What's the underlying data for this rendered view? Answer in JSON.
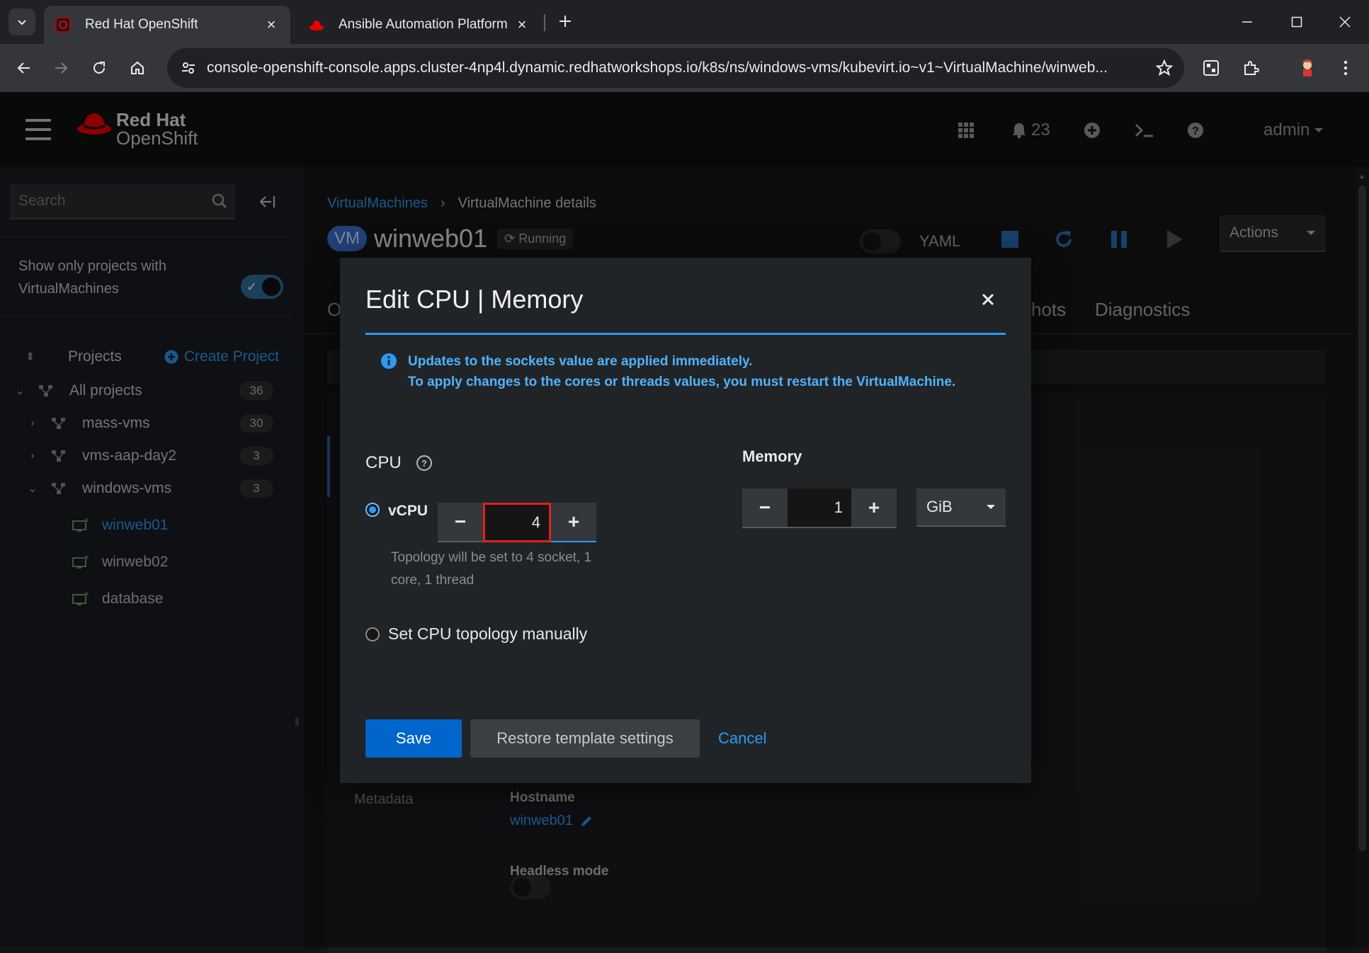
{
  "browser": {
    "tabs": [
      {
        "title": "Red Hat OpenShift",
        "active": true
      },
      {
        "title": "Ansible Automation Platform",
        "active": false
      }
    ],
    "url": "console-openshift-console.apps.cluster-4np4l.dynamic.redhatworkshops.io/k8s/ns/windows-vms/kubevirt.io~v1~VirtualMachine/winweb..."
  },
  "masthead": {
    "brand_line1": "Red Hat",
    "brand_line2": "OpenShift",
    "notifications_count": "23",
    "user": "admin"
  },
  "sidebar": {
    "search_placeholder": "Search",
    "filter_label": "Show only projects with VirtualMachines",
    "projects_label": "Projects",
    "create_project": "Create Project",
    "tree": [
      {
        "label": "All projects",
        "count": "36"
      },
      {
        "label": "mass-vms",
        "count": "30"
      },
      {
        "label": "vms-aap-day2",
        "count": "3"
      },
      {
        "label": "windows-vms",
        "count": "3"
      }
    ],
    "vms": [
      {
        "label": "winweb01",
        "selected": true
      },
      {
        "label": "winweb02",
        "selected": false
      },
      {
        "label": "database",
        "selected": false
      }
    ]
  },
  "page": {
    "breadcrumb_link": "VirtualMachines",
    "breadcrumb_current": "VirtualMachine details",
    "vm_badge": "VM",
    "vm_name": "winweb01",
    "vm_status": "Running",
    "yaml_label": "YAML",
    "actions_label": "Actions",
    "tab_partial_left": "O",
    "tab_partial_right": "hots",
    "tab_diagnostics": "Diagnostics",
    "metadata_label": "Metadata",
    "hostname_label": "Hostname",
    "hostname_value": "winweb01",
    "headless_label": "Headless mode"
  },
  "modal": {
    "title": "Edit CPU | Memory",
    "alert_line1": "Updates to the sockets value are applied immediately.",
    "alert_line2": "To apply changes to the cores or threads values, you must restart the VirtualMachine.",
    "cpu_label": "CPU",
    "vcpu_label": "vCPU",
    "vcpu_value": "4",
    "topology_help": "Topology will be set to 4 socket, 1 core, 1 thread",
    "manual_label": "Set CPU topology manually",
    "memory_label": "Memory",
    "memory_value": "1",
    "memory_unit": "GiB",
    "save_label": "Save",
    "restore_label": "Restore template settings",
    "cancel_label": "Cancel"
  },
  "colors": {
    "accent": "#2b9af3",
    "primary_button": "#0066cc",
    "highlight_box": "#e02020",
    "brand_red": "#ee0000"
  }
}
